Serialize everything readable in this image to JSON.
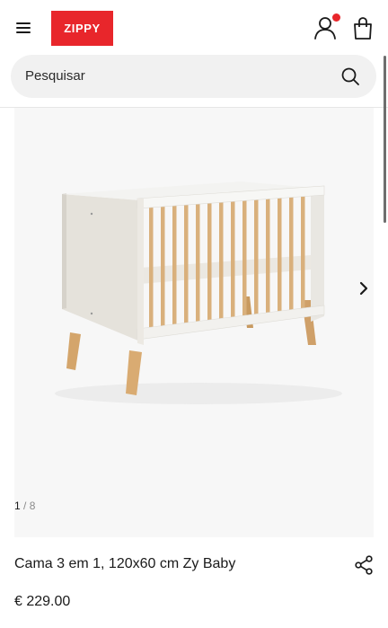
{
  "header": {
    "logo_text": "ZIPPY",
    "brand_color": "#e8262b",
    "icons": [
      "menu-icon",
      "account-icon",
      "bag-icon"
    ]
  },
  "search": {
    "placeholder": "Pesquisar",
    "icon": "search-icon"
  },
  "gallery": {
    "current": "1",
    "separator": "/",
    "total": "8",
    "next_icon": "chevron-right-icon"
  },
  "product": {
    "title": "Cama 3 em 1, 120x60 cm Zy Baby",
    "price": "€ 229.00",
    "share_icon": "share-icon"
  }
}
